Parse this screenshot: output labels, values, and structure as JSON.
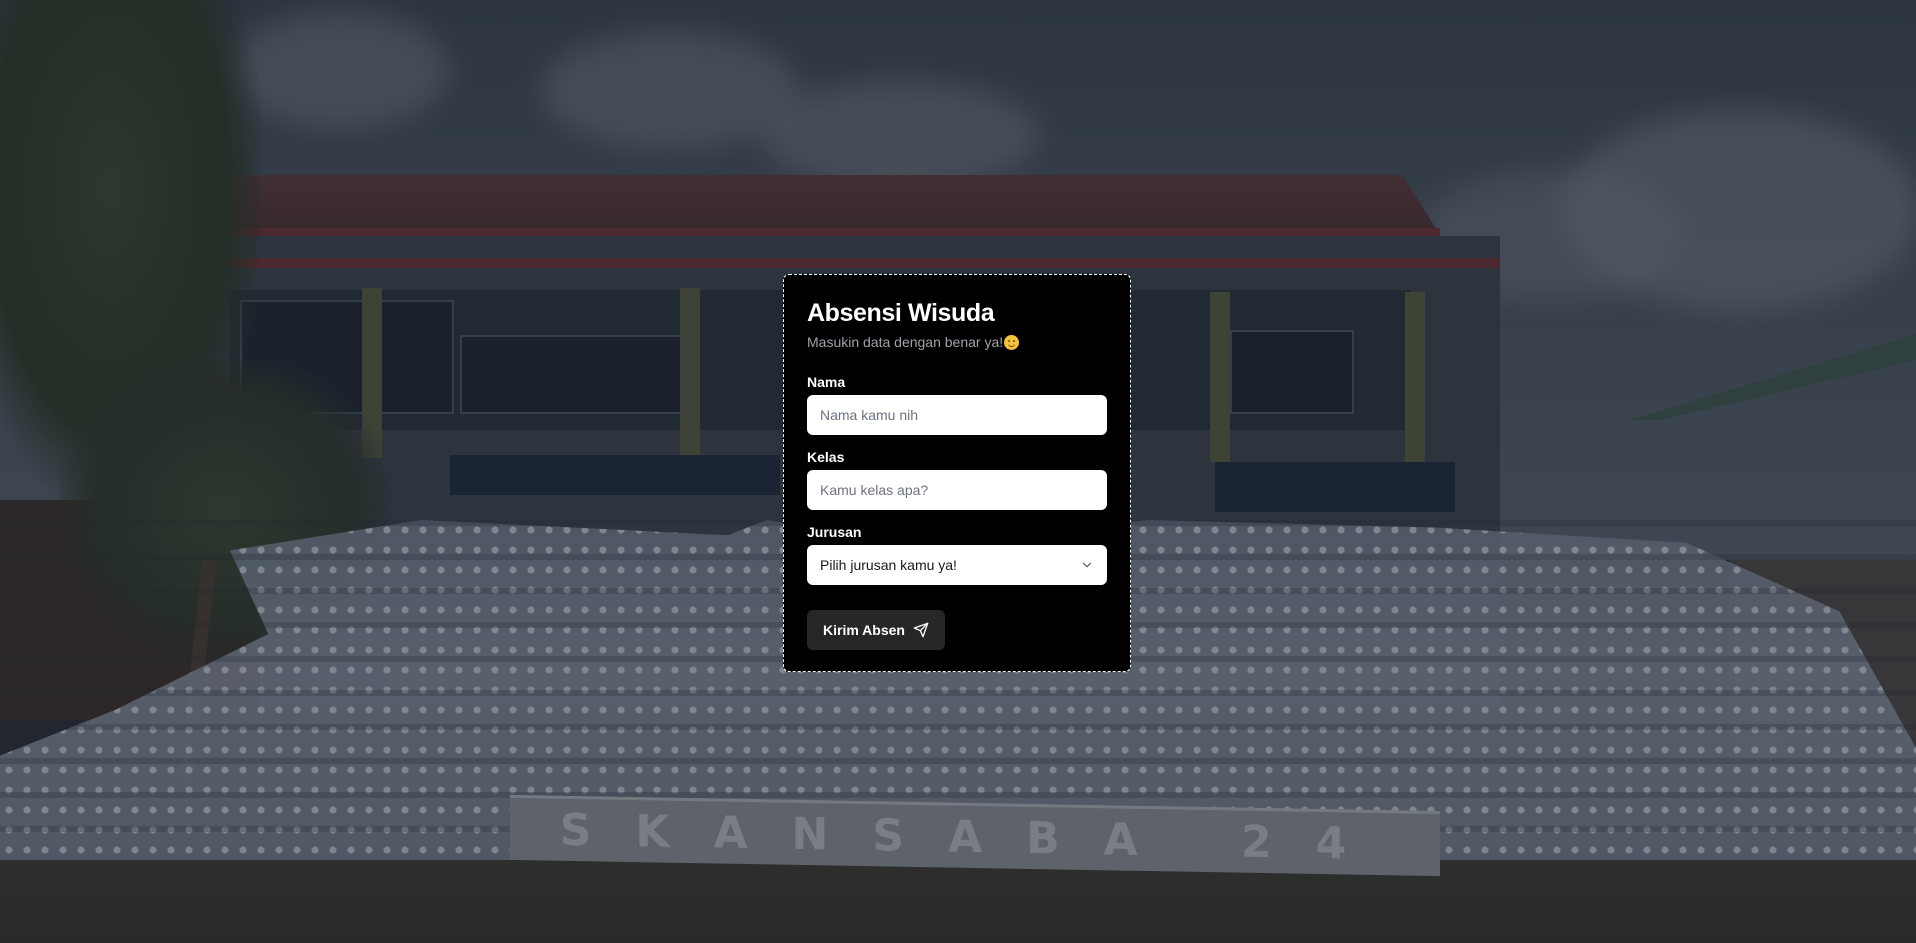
{
  "background": {
    "banner_text": "SKANSABA 24"
  },
  "form": {
    "title": "Absensi Wisuda",
    "subtitle": "Masukin data dengan benar ya!",
    "subtitle_emoji": "smiling-face",
    "fields": {
      "nama": {
        "label": "Nama",
        "value": "",
        "placeholder": "Nama kamu nih"
      },
      "kelas": {
        "label": "Kelas",
        "value": "",
        "placeholder": "Kamu kelas apa?"
      },
      "jurusan": {
        "label": "Jurusan",
        "selected": "Pilih jurusan kamu ya!"
      }
    },
    "submit": {
      "label": "Kirim Absen",
      "icon": "send-icon"
    }
  },
  "colors": {
    "card_background": "#000000",
    "card_border": "#ffffff",
    "button_background": "#27272a",
    "subtitle_text": "#a1a1aa"
  }
}
